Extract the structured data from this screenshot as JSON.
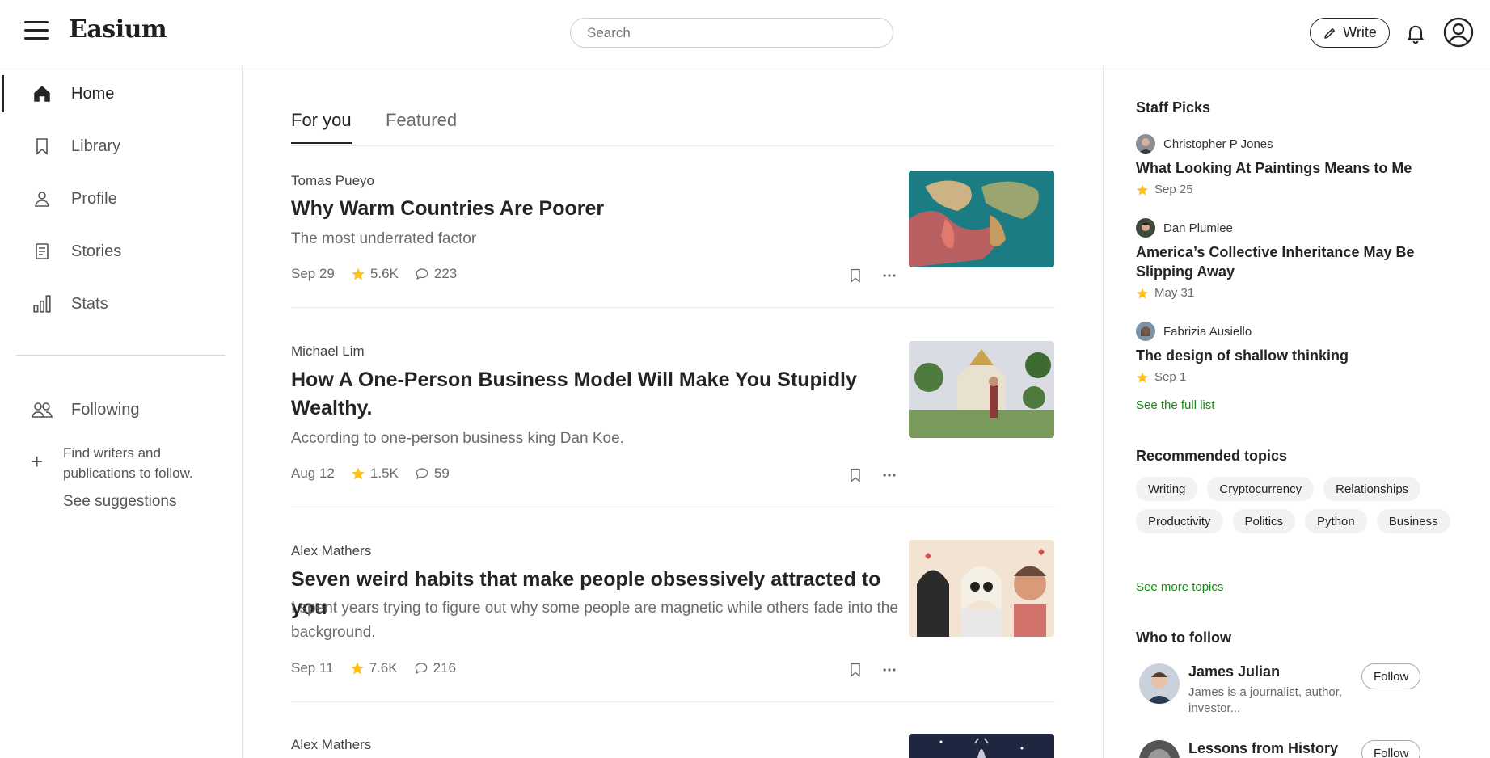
{
  "header": {
    "logo": "Easium",
    "search_placeholder": "Search",
    "write_label": "Write"
  },
  "sidebar": {
    "items": [
      {
        "label": "Home",
        "icon": "home-icon"
      },
      {
        "label": "Library",
        "icon": "bookmark-icon"
      },
      {
        "label": "Profile",
        "icon": "person-icon"
      },
      {
        "label": "Stories",
        "icon": "document-icon"
      },
      {
        "label": "Stats",
        "icon": "bar-chart-icon"
      }
    ],
    "following_label": "Following",
    "find_text": "Find writers and publications to follow.",
    "see_suggestions": "See suggestions"
  },
  "feed": {
    "tabs": [
      "For you",
      "Featured"
    ],
    "stories": [
      {
        "author": "Tomas Pueyo",
        "title": "Why Warm Countries Are Poorer",
        "subtitle": "The most underrated factor",
        "date": "Sep 29",
        "claps": "5.6K",
        "responses": "223"
      },
      {
        "author": "Michael Lim",
        "title": "How A One-Person Business Model Will Make You Stupidly Wealthy.",
        "subtitle": "According to one-person business king Dan Koe.",
        "date": "Aug 12",
        "claps": "1.5K",
        "responses": "59"
      },
      {
        "author": "Alex Mathers",
        "title": "Seven weird habits that make people obsessively attracted to you",
        "subtitle": "I spent years trying to figure out why some people are magnetic while others fade into the background.",
        "date": "Sep 11",
        "claps": "7.6K",
        "responses": "216"
      },
      {
        "author": "Alex Mathers"
      }
    ]
  },
  "right": {
    "staff_picks_title": "Staff Picks",
    "picks": [
      {
        "author": "Christopher P Jones",
        "title": "What Looking At Paintings Means to Me",
        "date": "Sep 25"
      },
      {
        "author": "Dan Plumlee",
        "title": "America’s Collective Inheritance May Be Slipping Away",
        "date": "May 31"
      },
      {
        "author": "Fabrizia Ausiello",
        "title": "The design of shallow thinking",
        "date": "Sep 1"
      }
    ],
    "see_full_list": "See the full list",
    "topics_title": "Recommended topics",
    "topics": [
      "Writing",
      "Cryptocurrency",
      "Relationships",
      "Productivity",
      "Politics",
      "Python",
      "Business"
    ],
    "see_more_topics": "See more topics",
    "who_to_follow_title": "Who to follow",
    "follow": [
      {
        "name": "James Julian",
        "bio": "James is a journalist, author, investor...",
        "button": "Follow"
      },
      {
        "name": "Lessons from History",
        "button": "Follow"
      }
    ]
  },
  "colors": {
    "accent_green": "#1a8917",
    "star": "#FFC017",
    "text": "#242424"
  }
}
